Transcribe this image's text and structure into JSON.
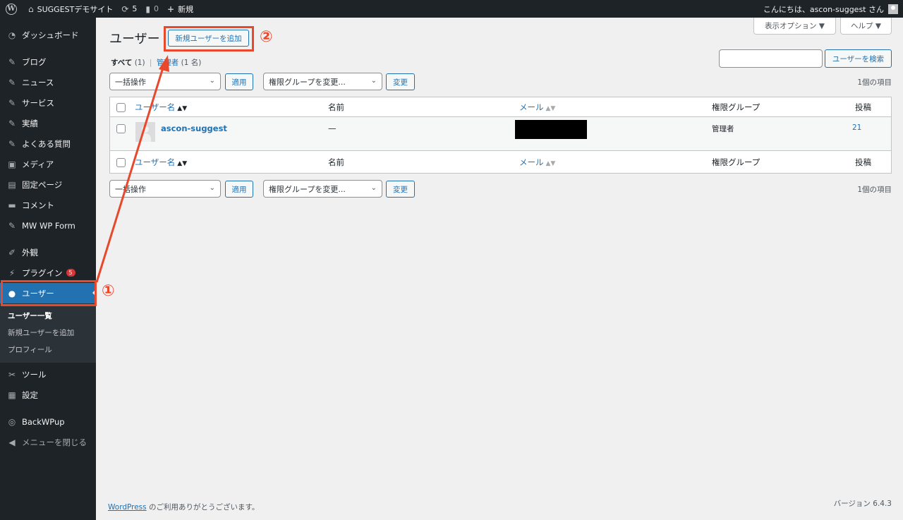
{
  "admin_bar": {
    "site_name": "SUGGESTデモサイト",
    "updates_count": "5",
    "comments_count": "0",
    "new_label": "新規",
    "greeting": "こんにちは、ascon-suggest さん"
  },
  "sidebar": {
    "items": [
      {
        "label": "ダッシュボード",
        "icon": "dashboard-icon"
      },
      {
        "label": "ブログ",
        "icon": "pin-icon"
      },
      {
        "label": "ニュース",
        "icon": "pin-icon"
      },
      {
        "label": "サービス",
        "icon": "pin-icon"
      },
      {
        "label": "実績",
        "icon": "pin-icon"
      },
      {
        "label": "よくある質問",
        "icon": "pin-icon"
      },
      {
        "label": "メディア",
        "icon": "media-icon"
      },
      {
        "label": "固定ページ",
        "icon": "page-icon"
      },
      {
        "label": "コメント",
        "icon": "comment-icon"
      },
      {
        "label": "MW WP Form",
        "icon": "pin-icon"
      },
      {
        "label": "外観",
        "icon": "brush-icon"
      },
      {
        "label": "プラグイン",
        "icon": "plugin-icon",
        "badge": "5"
      },
      {
        "label": "ユーザー",
        "icon": "user-icon"
      },
      {
        "label": "ツール",
        "icon": "wrench-icon"
      },
      {
        "label": "設定",
        "icon": "settings-icon"
      },
      {
        "label": "BackWPup",
        "icon": "backwpup-icon"
      },
      {
        "label": "メニューを閉じる",
        "icon": "collapse-icon"
      }
    ],
    "submenu": [
      "ユーザー一覧",
      "新規ユーザーを追加",
      "プロフィール"
    ]
  },
  "header": {
    "screen_options": "表示オプション ▼",
    "help": "ヘルプ ▼",
    "title": "ユーザー",
    "add_new": "新規ユーザーを追加"
  },
  "filters": {
    "all_label": "すべて",
    "all_count": "(1)",
    "separator": "|",
    "admin_label": "管理者",
    "admin_count": "(1 名)"
  },
  "search": {
    "value": "",
    "button": "ユーザーを検索"
  },
  "actions": {
    "bulk": "一括操作",
    "apply": "適用",
    "role_change": "権限グループを変更...",
    "change": "変更",
    "items_count": "1個の項目"
  },
  "table": {
    "headers": {
      "username": "ユーザー名",
      "name": "名前",
      "email": "メール",
      "role": "権限グループ",
      "posts": "投稿"
    },
    "rows": [
      {
        "username": "ascon-suggest",
        "name": "—",
        "role": "管理者",
        "posts": "21"
      }
    ]
  },
  "footer": {
    "wordpress": "WordPress",
    "thanks": " のご利用ありがとうございます。",
    "version": "バージョン 6.4.3"
  },
  "annotations": {
    "one": "①",
    "two": "②"
  },
  "colors": {
    "annotation": "#e8482c",
    "accent": "#2271b1",
    "sidebar_bg": "#1d2327"
  }
}
